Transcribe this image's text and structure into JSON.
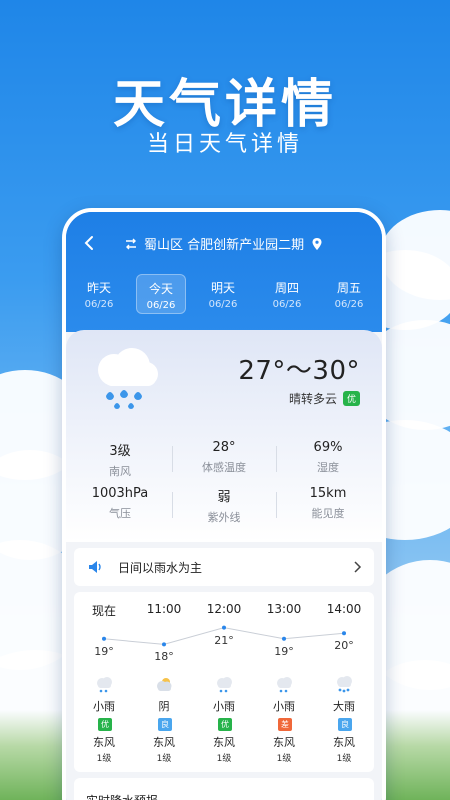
{
  "hero": {
    "title": "天气详情",
    "subtitle": "当日天气详情"
  },
  "topbar": {
    "back_icon": "chevron-left-icon",
    "swap_icon": "swap-arrows-icon",
    "location": "蜀山区 合肥创新产业园二期",
    "pin_icon": "location-pin-icon"
  },
  "days": [
    {
      "name": "昨天",
      "date": "06/26",
      "active": false
    },
    {
      "name": "今天",
      "date": "06/26",
      "active": true
    },
    {
      "name": "明天",
      "date": "06/26",
      "active": false
    },
    {
      "name": "周四",
      "date": "06/26",
      "active": false
    },
    {
      "name": "周五",
      "date": "06/26",
      "active": false
    }
  ],
  "today": {
    "icon": "rain-cloud-icon",
    "temp_range": "27°～30°",
    "condition": "晴转多云",
    "aqi": "优",
    "aqi_color": "#27b34a",
    "metrics": [
      {
        "value": "3级",
        "label": "南风"
      },
      {
        "value": "28°",
        "label": "体感温度"
      },
      {
        "value": "69%",
        "label": "湿度"
      },
      {
        "value": "1003hPa",
        "label": "气压"
      },
      {
        "value": "弱",
        "label": "紫外线"
      },
      {
        "value": "15km",
        "label": "能见度"
      }
    ]
  },
  "notice": {
    "icon": "speaker-icon",
    "text": "日间以雨水为主"
  },
  "hourly": [
    {
      "time": "现在",
      "temp": "19°",
      "temp_value": 19,
      "icon": "light-rain-icon",
      "cond": "小雨",
      "aqi": "优",
      "aqi_color": "#27b34a",
      "wind": "东风",
      "level": "1级"
    },
    {
      "time": "11:00",
      "temp": "18°",
      "temp_value": 18,
      "icon": "cloudy-icon",
      "cond": "阴",
      "aqi": "良",
      "aqi_color": "#4aa6ee",
      "wind": "东风",
      "level": "1级"
    },
    {
      "time": "12:00",
      "temp": "21°",
      "temp_value": 21,
      "icon": "light-rain-icon",
      "cond": "小雨",
      "aqi": "优",
      "aqi_color": "#27b34a",
      "wind": "东风",
      "level": "1级"
    },
    {
      "time": "13:00",
      "temp": "19°",
      "temp_value": 19,
      "icon": "light-rain-icon",
      "cond": "小雨",
      "aqi": "差",
      "aqi_color": "#f0683a",
      "wind": "东风",
      "level": "1级"
    },
    {
      "time": "14:00",
      "temp": "20°",
      "temp_value": 20,
      "icon": "heavy-rain-icon",
      "cond": "大雨",
      "aqi": "良",
      "aqi_color": "#4aa6ee",
      "wind": "东风",
      "level": "1级"
    }
  ],
  "precip": {
    "title": "实时降水预报"
  }
}
